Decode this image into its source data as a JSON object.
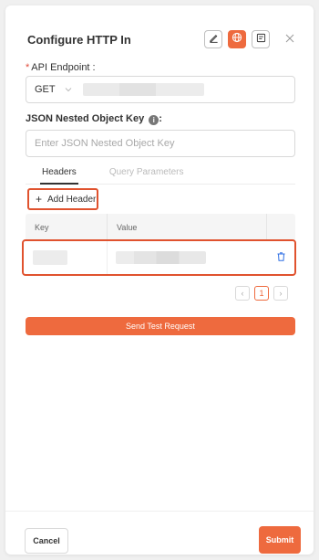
{
  "dialog": {
    "title": "Configure HTTP In",
    "header_buttons": [
      {
        "icon": "edit-icon"
      },
      {
        "icon": "globe-icon",
        "active": true
      },
      {
        "icon": "form-icon"
      }
    ],
    "close_icon": "close-icon"
  },
  "api_endpoint": {
    "label": "API Endpoint :",
    "required_mark": "*",
    "method": "GET",
    "method_chevron_icon": "chevron-down-icon"
  },
  "nested_key": {
    "label": "JSON Nested Object Key",
    "info_glyph": "i",
    "label_suffix": ":",
    "placeholder": "Enter JSON Nested Object Key"
  },
  "tabs": [
    {
      "label": "Headers",
      "active": true
    },
    {
      "label": "Query Parameters",
      "active": false
    }
  ],
  "add_header": {
    "plus": "+",
    "label": "Add Header"
  },
  "table": {
    "columns": [
      "Key",
      "Value"
    ],
    "delete_icon": "trash-icon"
  },
  "pagination": {
    "prev": "‹",
    "current": "1",
    "next": "›"
  },
  "send_test_request": "Send Test Request",
  "footer": {
    "cancel": "Cancel",
    "submit": "Submit"
  },
  "colors": {
    "accent": "#ee6a3e",
    "highlight_border": "#e0522e"
  }
}
